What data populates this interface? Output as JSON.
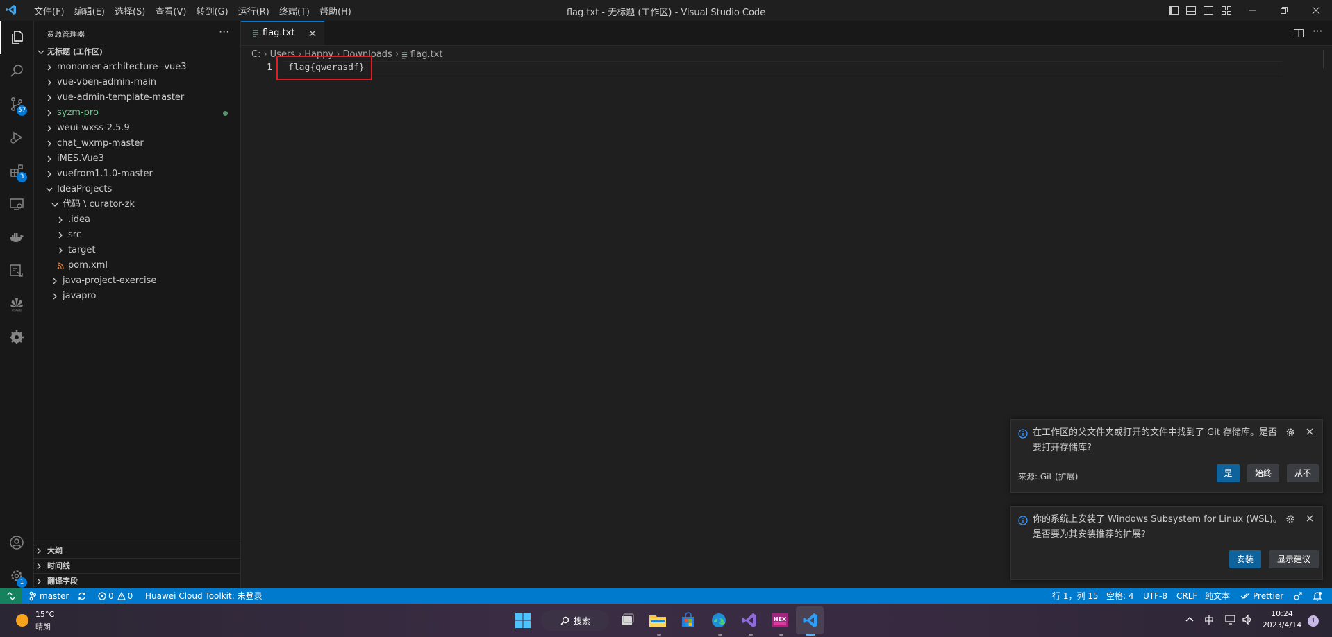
{
  "window": {
    "title": "flag.txt - 无标题 (工作区) - Visual Studio Code",
    "menu": [
      "文件(F)",
      "编辑(E)",
      "选择(S)",
      "查看(V)",
      "转到(G)",
      "运行(R)",
      "终端(T)",
      "帮助(H)"
    ]
  },
  "activity_bar": {
    "icons": [
      "explorer-icon",
      "search-icon",
      "source-control-icon",
      "run-debug-icon",
      "extensions-icon",
      "remote-explorer-icon",
      "docker-icon",
      "project-manager-icon",
      "huawei-icon",
      "settings-sync-icon",
      "account-icon",
      "manage-gear-icon"
    ],
    "source_control_badge": "57",
    "extensions_badge": "3",
    "manage_badge": "1"
  },
  "sidebar": {
    "title": "资源管理器",
    "more": "···",
    "workspace_label": "无标题 (工作区)",
    "tree": [
      {
        "label": "monomer-architecture--vue3",
        "state": "collapsed"
      },
      {
        "label": "vue-vben-admin-main",
        "state": "collapsed"
      },
      {
        "label": "vue-admin-template-master",
        "state": "collapsed"
      },
      {
        "label": "syzm-pro",
        "state": "collapsed",
        "color": "#73c991"
      },
      {
        "label": "weui-wxss-2.5.9",
        "state": "collapsed"
      },
      {
        "label": "chat_wxmp-master",
        "state": "collapsed"
      },
      {
        "label": "iMES.Vue3",
        "state": "collapsed"
      },
      {
        "label": "vuefrom1.1.0-master",
        "state": "collapsed"
      },
      {
        "label": "IdeaProjects",
        "state": "expanded"
      },
      {
        "label": "代码 \\ curator-zk",
        "state": "expanded"
      },
      {
        "label": ".idea",
        "state": "collapsed"
      },
      {
        "label": "src",
        "state": "collapsed"
      },
      {
        "label": "target",
        "state": "collapsed"
      },
      {
        "label": "pom.xml",
        "state": "file"
      },
      {
        "label": "java-project-exercise",
        "state": "collapsed"
      },
      {
        "label": "javapro",
        "state": "collapsed"
      }
    ],
    "sections": [
      "大纲",
      "时间线",
      "翻译字段"
    ]
  },
  "editor": {
    "tab_label": "flag.txt",
    "breadcrumb": [
      "C:",
      "Users",
      "Happy",
      "Downloads",
      "flag.txt"
    ],
    "line_number": "1",
    "code_line": "flag{qwerasdf}"
  },
  "notifications": [
    {
      "message": "在工作区的父文件夹或打开的文件中找到了 Git 存储库。是否要打开存储库?",
      "source": "来源: Git (扩展)",
      "buttons": [
        "是",
        "始终",
        "从不"
      ]
    },
    {
      "message": "你的系统上安装了 Windows Subsystem for Linux (WSL)。是否要为其安装推荐的扩展?",
      "buttons": [
        "安装",
        "显示建议"
      ]
    }
  ],
  "status_bar": {
    "branch": "master",
    "errors": "0",
    "warnings": "0",
    "huawei": "Huawei Cloud Toolkit: 未登录",
    "position": "行 1，列 15",
    "spaces": "空格: 4",
    "encoding": "UTF-8",
    "eol": "CRLF",
    "language": "纯文本",
    "prettier": "Prettier"
  },
  "taskbar": {
    "temperature": "15°C",
    "weather": "晴朗",
    "search": "搜索",
    "ime": "中",
    "time": "10:24",
    "date": "2023/4/14",
    "notification_count": "1",
    "app_icons": [
      "start-icon",
      "search-icon",
      "task-view-icon",
      "file-explorer-icon",
      "store-icon",
      "edge-icon",
      "visual-studio-icon",
      "hex-editor-icon",
      "vscode-icon"
    ]
  },
  "colors": {
    "accent": "#0078d4",
    "status_bar": "#007acc",
    "remote": "#16825d",
    "highlight_box": "#e51c23",
    "git_added": "#73c991"
  }
}
